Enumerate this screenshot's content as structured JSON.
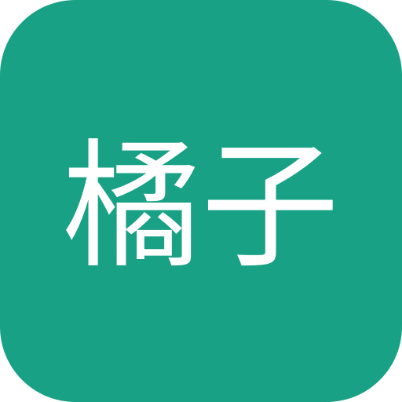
{
  "app_icon": {
    "label": "橘子",
    "background_color": "#18A185",
    "text_color": "#FFFFFF"
  }
}
